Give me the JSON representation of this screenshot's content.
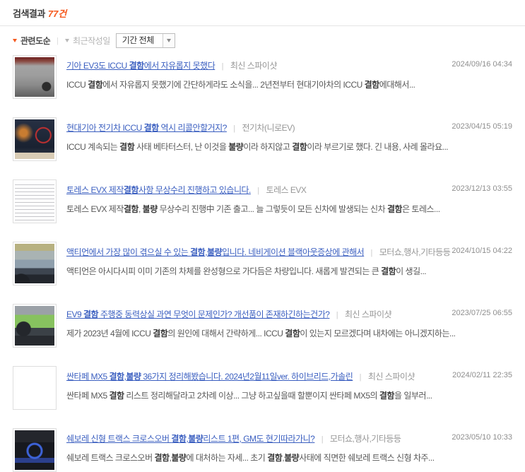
{
  "colors": {
    "accent_orange": "#f5591e",
    "link_blue": "#3b5fc0"
  },
  "ui": {
    "divider": "|"
  },
  "header": {
    "results_label": "검색결과",
    "results_count": "77건"
  },
  "toolbar": {
    "sort_relevance": "관련도순",
    "sort_recent": "최근작성일",
    "period_select": "기간 전체"
  },
  "results": [
    {
      "thumb_alt": "kia-ev3-gray-car-photo",
      "title_segments": [
        {
          "t": "기아 EV3도 ICCU ",
          "b": false
        },
        {
          "t": "결함",
          "b": true
        },
        {
          "t": "에서 자유롭지 못했다",
          "b": false
        }
      ],
      "source": "최신 스파이샷",
      "desc_segments": [
        {
          "t": "ICCU ",
          "b": false
        },
        {
          "t": "결함",
          "b": true
        },
        {
          "t": "에서 자유롭지 못했기에 간단하게라도 소식을... 2년전부터 현대기아차의 ICCU ",
          "b": false
        },
        {
          "t": "결함",
          "b": true
        },
        {
          "t": "에대해서...",
          "b": false
        }
      ],
      "date": "2024/09/16 04:34"
    },
    {
      "thumb_alt": "dashboard-screen-red-circle-photo",
      "title_segments": [
        {
          "t": "현대기아 전기차 ICCU ",
          "b": false
        },
        {
          "t": "결함",
          "b": true
        },
        {
          "t": " 역시 리콜안할거지?",
          "b": false
        }
      ],
      "source": "전기차(니로EV)",
      "desc_segments": [
        {
          "t": "ICCU 계속되는 ",
          "b": false
        },
        {
          "t": "결함",
          "b": true
        },
        {
          "t": " 사태 베타터스터, 난 이것을 ",
          "b": false
        },
        {
          "t": "불량",
          "b": true
        },
        {
          "t": "이라 하지않고 ",
          "b": false
        },
        {
          "t": "결함",
          "b": true
        },
        {
          "t": "이라 부르기로 했다. 긴 내용, 사례 몰라요...",
          "b": false
        }
      ],
      "date": "2023/04/15 05:19"
    },
    {
      "thumb_alt": "repair-notice-document-photo",
      "title_segments": [
        {
          "t": "토레스 EVX 제작",
          "b": false
        },
        {
          "t": "결함",
          "b": true
        },
        {
          "t": "사항 무상수리 진행하고 있습니다.",
          "b": false
        }
      ],
      "source": "토레스 EVX",
      "desc_segments": [
        {
          "t": "토레스 EVX 제작",
          "b": false
        },
        {
          "t": "결함",
          "b": true
        },
        {
          "t": ", ",
          "b": false
        },
        {
          "t": "불량",
          "b": true
        },
        {
          "t": " 무상수리 진행中 기존 출고... 늘 그렇듯이 모든 신차에 발생되는 신차 ",
          "b": false
        },
        {
          "t": "결함",
          "b": true
        },
        {
          "t": "은 토레스...",
          "b": false
        }
      ],
      "date": "2023/12/13 03:55"
    },
    {
      "thumb_alt": "windshield-view-photo",
      "title_segments": [
        {
          "t": "액티언에서 가장 많이 겪으실 수 있는 ",
          "b": false
        },
        {
          "t": "결함",
          "b": true
        },
        {
          "t": ",",
          "b": false
        },
        {
          "t": "불량",
          "b": true
        },
        {
          "t": "입니다. 네비게이션 블랙아웃증상에 관해서",
          "b": false
        }
      ],
      "source": "모터쇼,행사,기타등등",
      "desc_segments": [
        {
          "t": "액티언은 아시다시피 이미 기존의 차체를 완성형으로 가다듬은 차량입니다. 새롭게 발견되는 큰 ",
          "b": false
        },
        {
          "t": "결함",
          "b": true
        },
        {
          "t": "이 생길...",
          "b": false
        }
      ],
      "date": "2024/10/15 04:22"
    },
    {
      "thumb_alt": "car-interior-driver-photo",
      "title_segments": [
        {
          "t": "EV9 ",
          "b": false
        },
        {
          "t": "결함",
          "b": true
        },
        {
          "t": " 주행중 동력상실 과연 무엇이 문제인가? 개선품이 존재하긴하는건가?",
          "b": false
        }
      ],
      "source": "최신 스파이샷",
      "desc_segments": [
        {
          "t": "제가 2023년 4월에 ICCU ",
          "b": false
        },
        {
          "t": "결함",
          "b": true
        },
        {
          "t": "의 원인에 대해서 간략하게... ICCU ",
          "b": false
        },
        {
          "t": "결함",
          "b": true
        },
        {
          "t": "이 있는지 모르겠다며 내차에는 아니겠지하는...",
          "b": false
        }
      ],
      "date": "2023/07/25 06:55"
    },
    {
      "thumb_alt": "highway-traffic-photo",
      "title_segments": [
        {
          "t": "싼타페 MX5 ",
          "b": false
        },
        {
          "t": "결함",
          "b": true
        },
        {
          "t": ",",
          "b": false
        },
        {
          "t": "불량",
          "b": true
        },
        {
          "t": " 36가지 정리해봤습니다. 2024년2월11일ver. 하이브리드,가솔린",
          "b": false
        }
      ],
      "source": "최신 스파이샷",
      "desc_segments": [
        {
          "t": "싼타페 MX5 ",
          "b": false
        },
        {
          "t": "결함",
          "b": true
        },
        {
          "t": " 리스트 정리해달라고 2차례 이상... 그냥 하고싶을때 할뿐이지 싼타페 MX5의 ",
          "b": false
        },
        {
          "t": "결함",
          "b": true
        },
        {
          "t": "을 일부러...",
          "b": false
        }
      ],
      "date": "2024/02/11 22:35"
    },
    {
      "thumb_alt": "dark-car-blue-light-photo",
      "title_segments": [
        {
          "t": "쉐보레 신형 트랙스 크로스오버 ",
          "b": false
        },
        {
          "t": "결함",
          "b": true
        },
        {
          "t": ",",
          "b": false
        },
        {
          "t": "불량",
          "b": true
        },
        {
          "t": "리스트 1편, GM도 현기따라가니?",
          "b": false
        }
      ],
      "source": "모터쇼,행사,기타등등",
      "desc_segments": [
        {
          "t": "쉐보레 트랙스 크로스오버 ",
          "b": false
        },
        {
          "t": "결함",
          "b": true
        },
        {
          "t": ",",
          "b": false
        },
        {
          "t": "불량",
          "b": true
        },
        {
          "t": "에 대처하는 자세... 초기 ",
          "b": false
        },
        {
          "t": "결함",
          "b": true
        },
        {
          "t": ",",
          "b": false
        },
        {
          "t": "불량",
          "b": true
        },
        {
          "t": "사태에 직면한 쉐보레 트랙스 신형 차주...",
          "b": false
        }
      ],
      "date": "2023/05/10 10:33"
    }
  ]
}
